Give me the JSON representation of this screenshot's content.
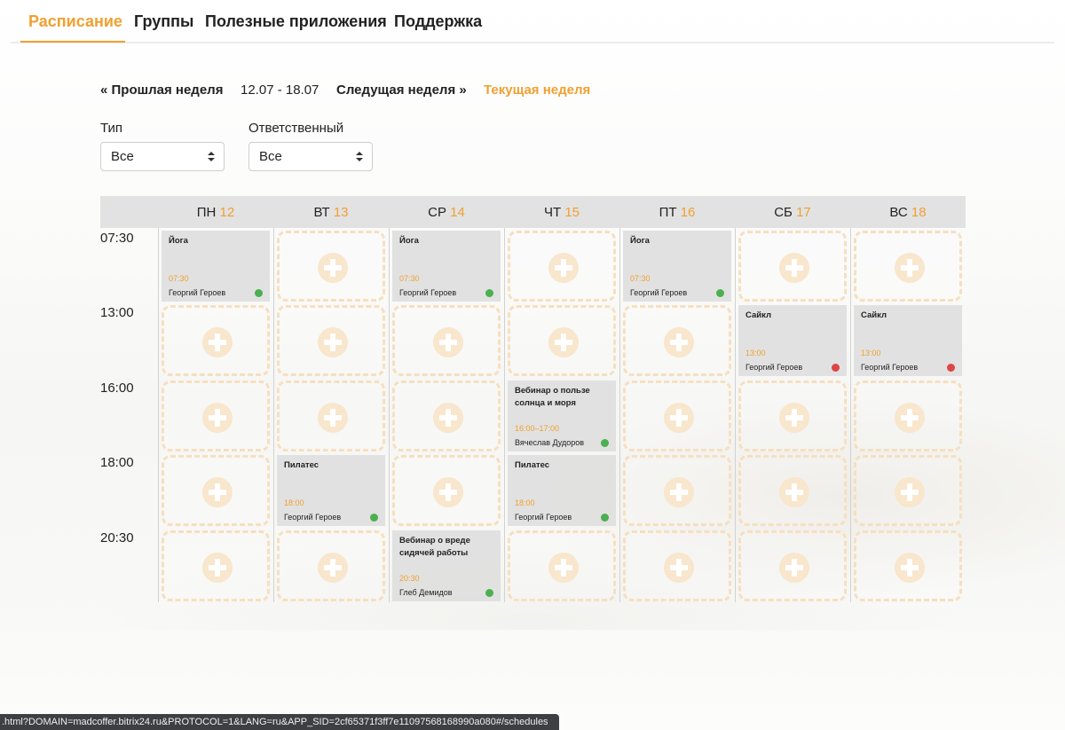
{
  "nav": {
    "tabs": [
      {
        "label": "Расписание",
        "active": true
      },
      {
        "label": "Группы"
      },
      {
        "label": "Полезные приложения"
      },
      {
        "label": "Поддержка"
      }
    ]
  },
  "week": {
    "prev": "« Прошлая неделя",
    "range": "12.07 - 18.07",
    "next": "Следущая неделя »",
    "current": "Текущая неделя"
  },
  "filters": {
    "type": {
      "label": "Тип",
      "value": "Все"
    },
    "owner": {
      "label": "Ответственный",
      "value": "Все"
    }
  },
  "days": [
    {
      "name": "ПН",
      "num": "12"
    },
    {
      "name": "ВТ",
      "num": "13"
    },
    {
      "name": "СР",
      "num": "14"
    },
    {
      "name": "ЧТ",
      "num": "15"
    },
    {
      "name": "ПТ",
      "num": "16"
    },
    {
      "name": "СБ",
      "num": "17"
    },
    {
      "name": "ВС",
      "num": "18"
    }
  ],
  "times": [
    "07:30",
    "13:00",
    "16:00",
    "18:00",
    "20:30"
  ],
  "events": [
    {
      "day": 0,
      "row": 0,
      "title": "Йога",
      "time": "07:30",
      "person": "Георгий Героев",
      "status": "green"
    },
    {
      "day": 2,
      "row": 0,
      "title": "Йога",
      "time": "07:30",
      "person": "Георгий Героев",
      "status": "green"
    },
    {
      "day": 4,
      "row": 0,
      "title": "Йога",
      "time": "07:30",
      "person": "Георгий Героев",
      "status": "green"
    },
    {
      "day": 5,
      "row": 1,
      "title": "Сайкл",
      "time": "13:00",
      "person": "Георгий Героев",
      "status": "red"
    },
    {
      "day": 6,
      "row": 1,
      "title": "Сайкл",
      "time": "13:00",
      "person": "Георгий Героев",
      "status": "red"
    },
    {
      "day": 3,
      "row": 2,
      "title": "Вебинар о пользе солнца и моря",
      "time": "16:00–17:00",
      "person": "Вячеслав Дудоров",
      "status": "green"
    },
    {
      "day": 1,
      "row": 3,
      "title": "Пилатес",
      "time": "18:00",
      "person": "Георгий Героев",
      "status": "green"
    },
    {
      "day": 3,
      "row": 3,
      "title": "Пилатес",
      "time": "18:00",
      "person": "Георгий Героев",
      "status": "green"
    },
    {
      "day": 2,
      "row": 4,
      "title": "Вебинар о вреде сидячей работы",
      "time": "20:30",
      "person": "Глеб Демидов",
      "status": "green"
    }
  ],
  "statusbar": ".html?DOMAIN=madcoffer.bitrix24.ru&PROTOCOL=1&LANG=ru&APP_SID=2cf65371f3ff7e11097568168990a080#/schedules",
  "colors": {
    "accent": "#f0a030",
    "status_green": "#4caf50",
    "status_red": "#dd4444"
  }
}
